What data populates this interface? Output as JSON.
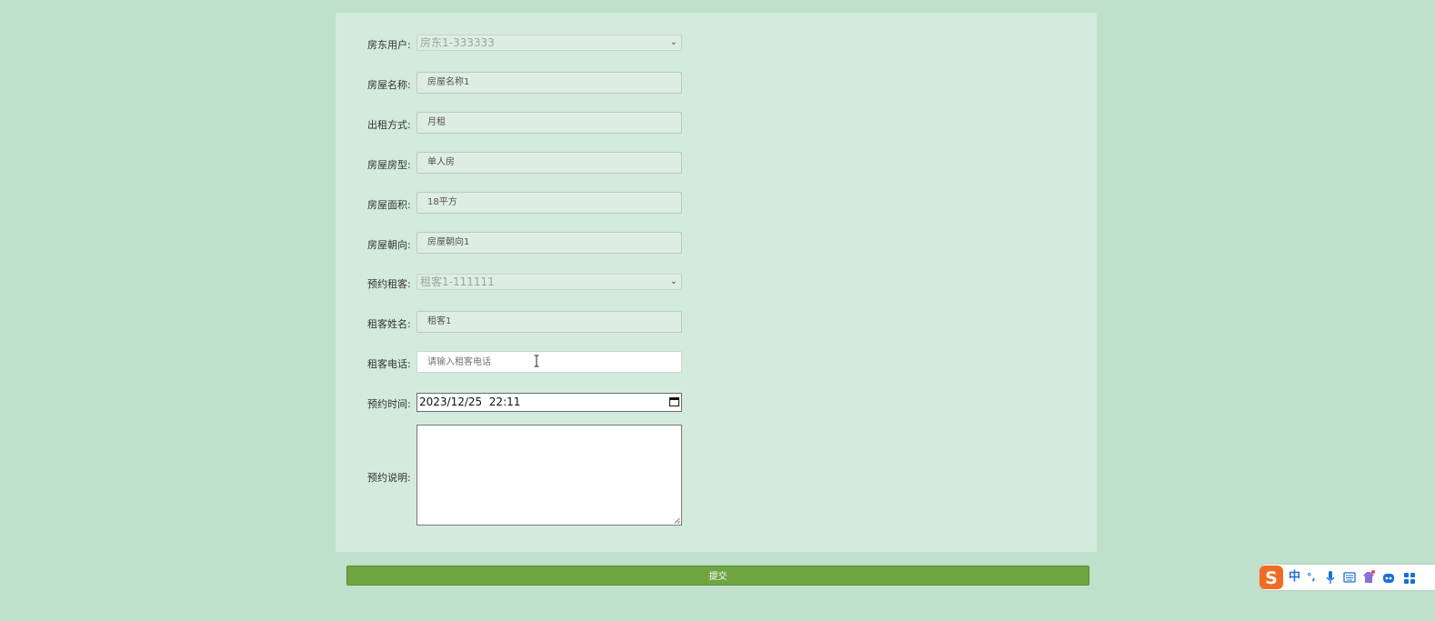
{
  "form": {
    "landlord_user": {
      "label": "房东用户:",
      "value": "房东1-333333"
    },
    "house_name": {
      "label": "房屋名称:",
      "value": "房屋名称1"
    },
    "rent_method": {
      "label": "出租方式:",
      "value": "月租"
    },
    "house_type": {
      "label": "房屋房型:",
      "value": "单人房"
    },
    "house_area": {
      "label": "房屋面积:",
      "value": "18平方"
    },
    "house_orientation": {
      "label": "房屋朝向:",
      "value": "房屋朝向1"
    },
    "tenant_user": {
      "label": "预约租客:",
      "value": "租客1-111111"
    },
    "tenant_name": {
      "label": "租客姓名:",
      "value": "租客1"
    },
    "tenant_phone": {
      "label": "租客电话:",
      "value": "",
      "placeholder": "请输入租客电话"
    },
    "appointment_time": {
      "label": "预约时间:",
      "value": "2023/12/25  22:11"
    },
    "appointment_note": {
      "label": "预约说明:",
      "value": ""
    }
  },
  "submit_label": "提交",
  "ime": {
    "mode_label": "中",
    "punct_label": "°,",
    "brand_color": "#f26b22",
    "accent_color": "#1a6fd6"
  },
  "colors": {
    "page_background": "#bfe0cb",
    "panel_background": "#d3ebdd",
    "submit_background": "#6ea541"
  }
}
